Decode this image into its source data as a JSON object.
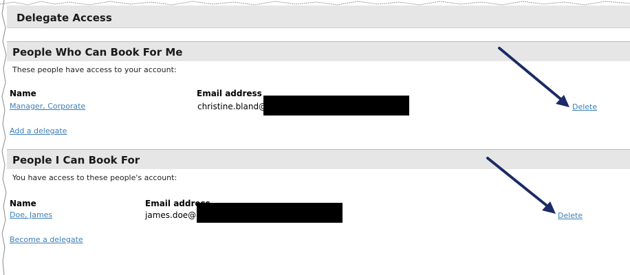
{
  "page": {
    "title": "Delegate Access"
  },
  "sections": [
    {
      "title": "People Who Can Book For Me",
      "description": "These people have access to your account:",
      "columns": {
        "name": "Name",
        "email": "Email address"
      },
      "rows": [
        {
          "name": "Manager, Corporate",
          "email": "christine.bland@",
          "action": "Delete"
        }
      ],
      "add_link": "Add a delegate"
    },
    {
      "title": "People I Can Book For",
      "description": "You have access to these people's account:",
      "columns": {
        "name": "Name",
        "email": "Email address"
      },
      "rows": [
        {
          "name": "Doe, James",
          "email": "james.doe@",
          "action": "Delete"
        }
      ],
      "add_link": "Become a delegate"
    }
  ],
  "colors": {
    "link": "#3a7fb8",
    "header_bg": "#e6e6e6",
    "annotation_arrow": "#1c2a66",
    "redaction": "#000000"
  },
  "icons": {
    "annotation": "arrow-pointer-icon"
  }
}
